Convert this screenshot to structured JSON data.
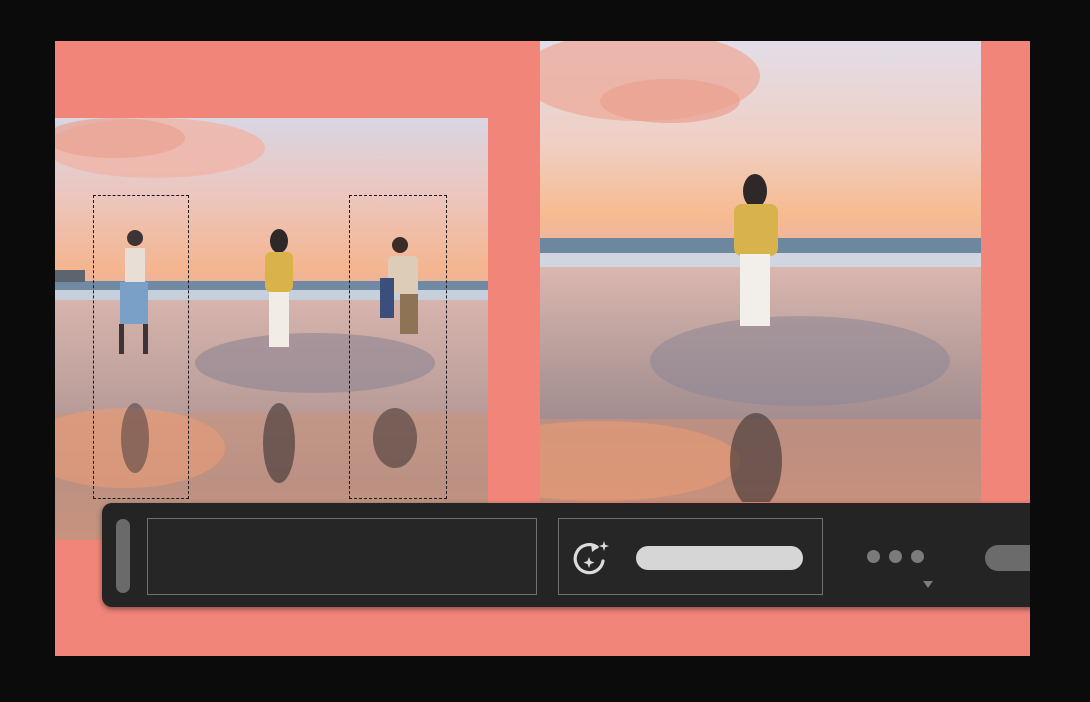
{
  "toolbar": {
    "prompt_value": "",
    "prompt_placeholder": "",
    "icons": {
      "generate": "generate-refresh-sparkle-icon",
      "more": "more-dots-icon",
      "caret": "caret-down-icon"
    }
  },
  "colors": {
    "backdrop": "#0b0b0b",
    "stage": "#f2857a",
    "toolbar": "#242424",
    "toolbar_border": "#707070",
    "pill": "#d6d6d6"
  }
}
